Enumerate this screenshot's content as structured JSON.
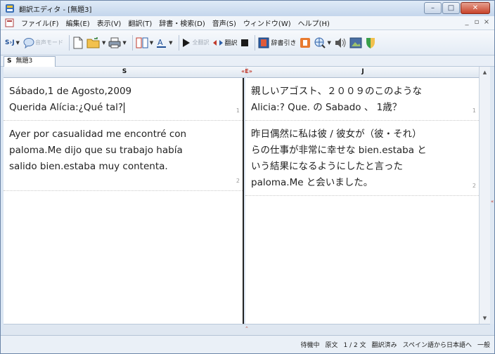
{
  "window": {
    "title": "翻訳エディタ - [無題3]"
  },
  "menu": {
    "items": [
      "ファイル(F)",
      "編集(E)",
      "表示(V)",
      "翻訳(T)",
      "辞書・検索(D)",
      "音声(S)",
      "ウィンドウ(W)",
      "ヘルプ(H)"
    ]
  },
  "toolbar": {
    "lang_pair_label": "S›J",
    "dictation_label": "音声モード",
    "translate_all_label": "全翻訳",
    "translate_label": "翻訳",
    "paste_label": "辞書引き"
  },
  "doc_tab": {
    "label": "S",
    "name": "無題3"
  },
  "columns": {
    "source_header": "S",
    "target_header": "J",
    "swap_label": "«E»"
  },
  "source_segments": [
    {
      "lines": [
        "Sábado,1 de Agosto,2009",
        "Querida Alícia:¿Qué tal?"
      ],
      "number": "1"
    },
    {
      "lines": [
        "Ayer por casualidad me encontré con",
        "paloma.Me dijo que su trabajo había",
        "salido bien.estaba muy contenta."
      ],
      "number": "2"
    }
  ],
  "target_segments": [
    {
      "lines": [
        "親しいアゴスト、２００９のこのような",
        "Alicia:? Que. の Sabado 、 1歳？"
      ],
      "number": "1"
    },
    {
      "lines": [
        "昨日偶然に私は彼 / 彼女が（彼・それ）",
        "らの仕事が非常に幸せな bien.estaba と",
        "いう結果になるようにしたと言った",
        "paloma.Me と会いました。"
      ],
      "number": "2"
    }
  ],
  "status": {
    "state": "待機中",
    "mode": "原文",
    "sentence_count": "1 / 2 文",
    "translated": "翻訳済み",
    "direction": "スペイン語から日本語へ",
    "field": "一般"
  },
  "colors": {
    "titlebar": "#c4d6ec",
    "accent_red": "#c0392b",
    "pane_divider": "#222222"
  }
}
